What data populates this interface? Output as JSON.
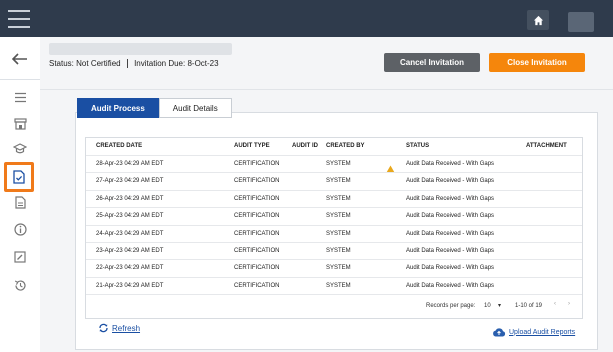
{
  "header": {
    "status_label": "Status:",
    "status_value": "Not Certified",
    "invitation_label": "Invitation Due:",
    "invitation_value": "8-Oct-23",
    "cancel_label": "Cancel Invitation",
    "close_label": "Close Invitation"
  },
  "tabs": [
    {
      "label": "Audit Process",
      "active": true
    },
    {
      "label": "Audit Details",
      "active": false
    }
  ],
  "table": {
    "columns": [
      "CREATED DATE",
      "AUDIT TYPE",
      "AUDIT ID",
      "CREATED BY",
      "STATUS",
      "ATTACHMENT"
    ],
    "rows": [
      {
        "created_date": "28-Apr-23 04:29 AM EDT",
        "audit_type": "CERTIFICATION",
        "audit_id": "",
        "created_by": "SYSTEM",
        "warning": true,
        "status": "Audit Data Received - With Gaps"
      },
      {
        "created_date": "27-Apr-23 04:29 AM EDT",
        "audit_type": "CERTIFICATION",
        "audit_id": "",
        "created_by": "SYSTEM",
        "warning": false,
        "status": "Audit Data Received - With Gaps"
      },
      {
        "created_date": "26-Apr-23 04:29 AM EDT",
        "audit_type": "CERTIFICATION",
        "audit_id": "",
        "created_by": "SYSTEM",
        "warning": false,
        "status": "Audit Data Received - With Gaps"
      },
      {
        "created_date": "25-Apr-23 04:29 AM EDT",
        "audit_type": "CERTIFICATION",
        "audit_id": "",
        "created_by": "SYSTEM",
        "warning": false,
        "status": "Audit Data Received - With Gaps"
      },
      {
        "created_date": "24-Apr-23 04:29 AM EDT",
        "audit_type": "CERTIFICATION",
        "audit_id": "",
        "created_by": "SYSTEM",
        "warning": false,
        "status": "Audit Data Received - With Gaps"
      },
      {
        "created_date": "23-Apr-23 04:29 AM EDT",
        "audit_type": "CERTIFICATION",
        "audit_id": "",
        "created_by": "SYSTEM",
        "warning": false,
        "status": "Audit Data Received - With Gaps"
      },
      {
        "created_date": "22-Apr-23 04:29 AM EDT",
        "audit_type": "CERTIFICATION",
        "audit_id": "",
        "created_by": "SYSTEM",
        "warning": false,
        "status": "Audit Data Received - With Gaps"
      },
      {
        "created_date": "21-Apr-23 04:29 AM EDT",
        "audit_type": "CERTIFICATION",
        "audit_id": "",
        "created_by": "SYSTEM",
        "warning": false,
        "status": "Audit Data Received - With Gaps"
      }
    ]
  },
  "pagination": {
    "records_label": "Records per page:",
    "records_value": "10",
    "range": "1-10 of 19"
  },
  "actions": {
    "refresh_label": "Refresh",
    "upload_label": "Upload Audit Reports"
  },
  "colors": {
    "topbar": "#2f3b4c",
    "accent_blue": "#1a4fa3",
    "close_orange": "#f5860c",
    "active_sidebar_border": "#f07a1a",
    "warning": "#e9a81c"
  },
  "sidebar_icons": [
    "list-icon",
    "store-icon",
    "graduation-cap-icon",
    "audit-document-icon",
    "document-icon",
    "info-icon",
    "edit-icon",
    "history-icon"
  ]
}
